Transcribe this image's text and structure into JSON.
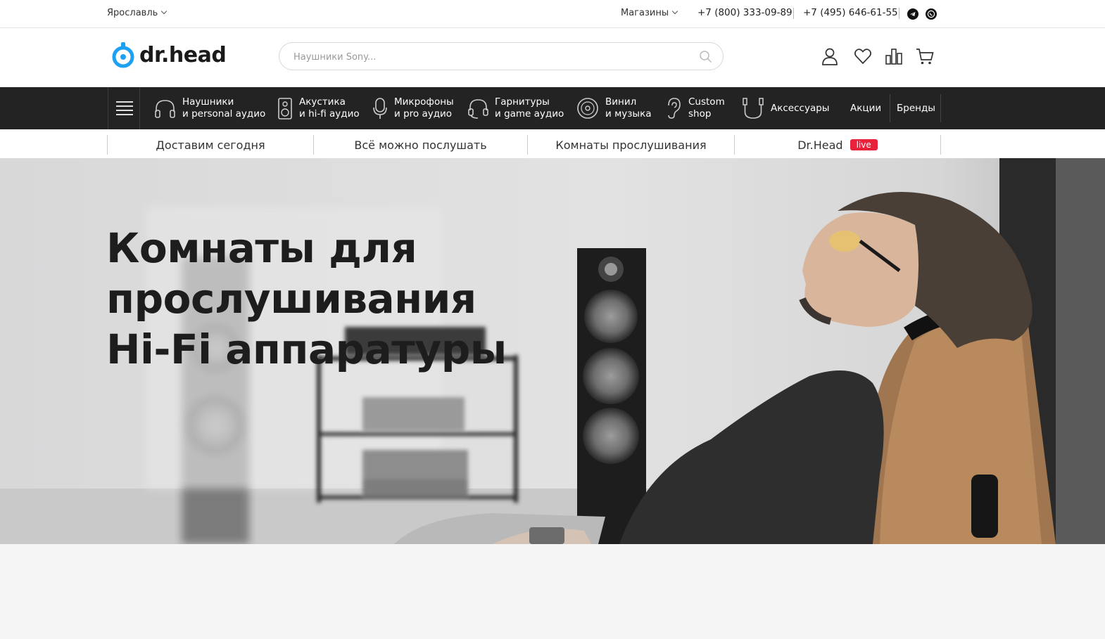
{
  "topbar": {
    "city": "Ярославль",
    "stores": "Магазины",
    "phone1": "+7 (800) 333-09-89",
    "phone2": "+7 (495) 646-61-55"
  },
  "header": {
    "logo_text": "dr.head",
    "search_placeholder": "Наушники Sony...",
    "icons": [
      "user-icon",
      "heart-icon",
      "compare-icon",
      "cart-icon"
    ]
  },
  "nav": {
    "items": [
      {
        "line1": "Наушники",
        "line2": "и personal аудио",
        "icon": "headphones-icon"
      },
      {
        "line1": "Акустика",
        "line2": "и hi-fi аудио",
        "icon": "speaker-icon"
      },
      {
        "line1": "Микрофоны",
        "line2": "и pro аудио",
        "icon": "microphone-icon"
      },
      {
        "line1": "Гарнитуры",
        "line2": "и game аудио",
        "icon": "headset-icon"
      },
      {
        "line1": "Винил",
        "line2": "и музыка",
        "icon": "vinyl-icon"
      },
      {
        "line1": "Custom",
        "line2": "shop",
        "icon": "ear-icon"
      },
      {
        "line1": "Аксессуары",
        "line2": "",
        "icon": "cable-icon"
      },
      {
        "line1": "Акции",
        "line2": ""
      },
      {
        "line1": "Бренды",
        "line2": ""
      }
    ]
  },
  "subnav": {
    "items": [
      "Доставим сегодня",
      "Всё можно послушать",
      "Комнаты прослушивания",
      "Dr.Head"
    ],
    "live_badge": "live"
  },
  "hero": {
    "title_lines": [
      "Комнаты для",
      "прослушивания",
      "Hi-Fi аппаратуры"
    ]
  },
  "colors": {
    "brand_blue": "#1da1f2",
    "nav_bg": "#232323",
    "live_red": "#e8223a"
  }
}
